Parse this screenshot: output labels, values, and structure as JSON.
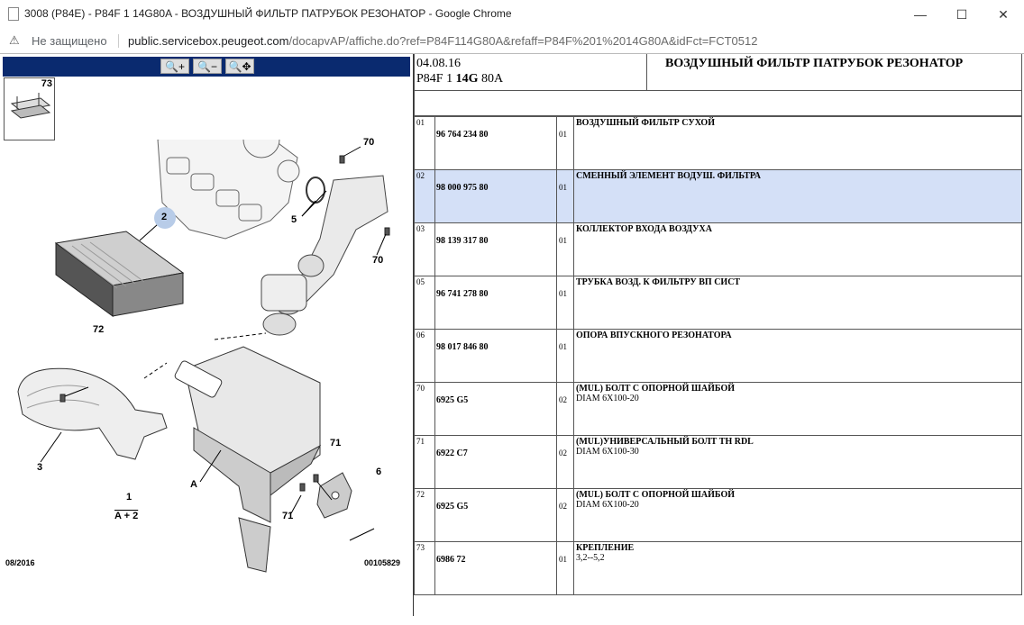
{
  "window": {
    "title": "3008 (P84E) - P84F 1 14G80A - ВОЗДУШНЫЙ ФИЛЬТР ПАТРУБОК РЕЗОНАТОР - Google Chrome",
    "minimize": "—",
    "maximize": "☐",
    "close": "✕"
  },
  "address": {
    "security_label": "Не защищено",
    "host": "public.servicebox.peugeot.com",
    "path": "/docapvAP/affiche.do?ref=P84F114G80A&refaff=P84F%201%2014G80A&idFct=FCT0512"
  },
  "zoom": {
    "zoom_in": "🔍+",
    "zoom_out": "🔍−",
    "zoom_fit": "🔍✥"
  },
  "thumbnail": {
    "label": "73"
  },
  "diagram": {
    "callouts": {
      "c2": "2",
      "c70a": "70",
      "c5": "5",
      "c70b": "70",
      "c72": "72",
      "c3": "3",
      "cA": "A",
      "c71a": "71",
      "c6": "6",
      "c71b": "71",
      "c1": "1",
      "cA2": "A + 2"
    },
    "footer_left": "08/2016",
    "footer_right": "00105829"
  },
  "header": {
    "date": "04.08.16",
    "code_prefix": "P84F 1 ",
    "code_bold": "14G",
    "code_suffix": " 80A",
    "name": "ВОЗДУШНЫЙ ФИЛЬТР ПАТРУБОК РЕЗОНАТОР"
  },
  "parts": [
    {
      "ref": "01",
      "part": "96 764 234 80",
      "qty": "01",
      "desc": "ВОЗДУШНЫЙ ФИЛЬТР СУХОЙ",
      "desc2": "",
      "selected": false
    },
    {
      "ref": "02",
      "part": "98 000 975 80",
      "qty": "01",
      "desc": "СМЕННЫЙ ЭЛЕМЕНТ ВОДУШ. ФИЛЬТРА",
      "desc2": "",
      "selected": true
    },
    {
      "ref": "03",
      "part": "98 139 317 80",
      "qty": "01",
      "desc": "КОЛЛЕКТОР ВХОДА ВОЗДУХА",
      "desc2": "",
      "selected": false
    },
    {
      "ref": "05",
      "part": "96 741 278 80",
      "qty": "01",
      "desc": "ТРУБКА ВОЗД. К ФИЛЬТРУ ВП СИСТ",
      "desc2": "",
      "selected": false
    },
    {
      "ref": "06",
      "part": "98 017 846 80",
      "qty": "01",
      "desc": "ОПОРА ВПУСКНОГО РЕЗОНАТОРА",
      "desc2": "",
      "selected": false
    },
    {
      "ref": "70",
      "part": "6925 G5",
      "qty": "02",
      "desc": "(MUL) БОЛТ С ОПОРНОЙ ШАЙБОЙ",
      "desc2": "DIAM 6X100-20",
      "selected": false
    },
    {
      "ref": "71",
      "part": "6922 C7",
      "qty": "02",
      "desc": "(MUL)УНИВЕРСАЛЬНЫЙ БОЛТ TH RDL",
      "desc2": "DIAM 6X100-30",
      "selected": false
    },
    {
      "ref": "72",
      "part": "6925 G5",
      "qty": "02",
      "desc": "(MUL) БОЛТ С ОПОРНОЙ ШАЙБОЙ",
      "desc2": "DIAM 6X100-20",
      "selected": false
    },
    {
      "ref": "73",
      "part": "6986 72",
      "qty": "01",
      "desc": "КРЕПЛЕНИЕ",
      "desc2": "3,2--5,2",
      "selected": false
    }
  ]
}
